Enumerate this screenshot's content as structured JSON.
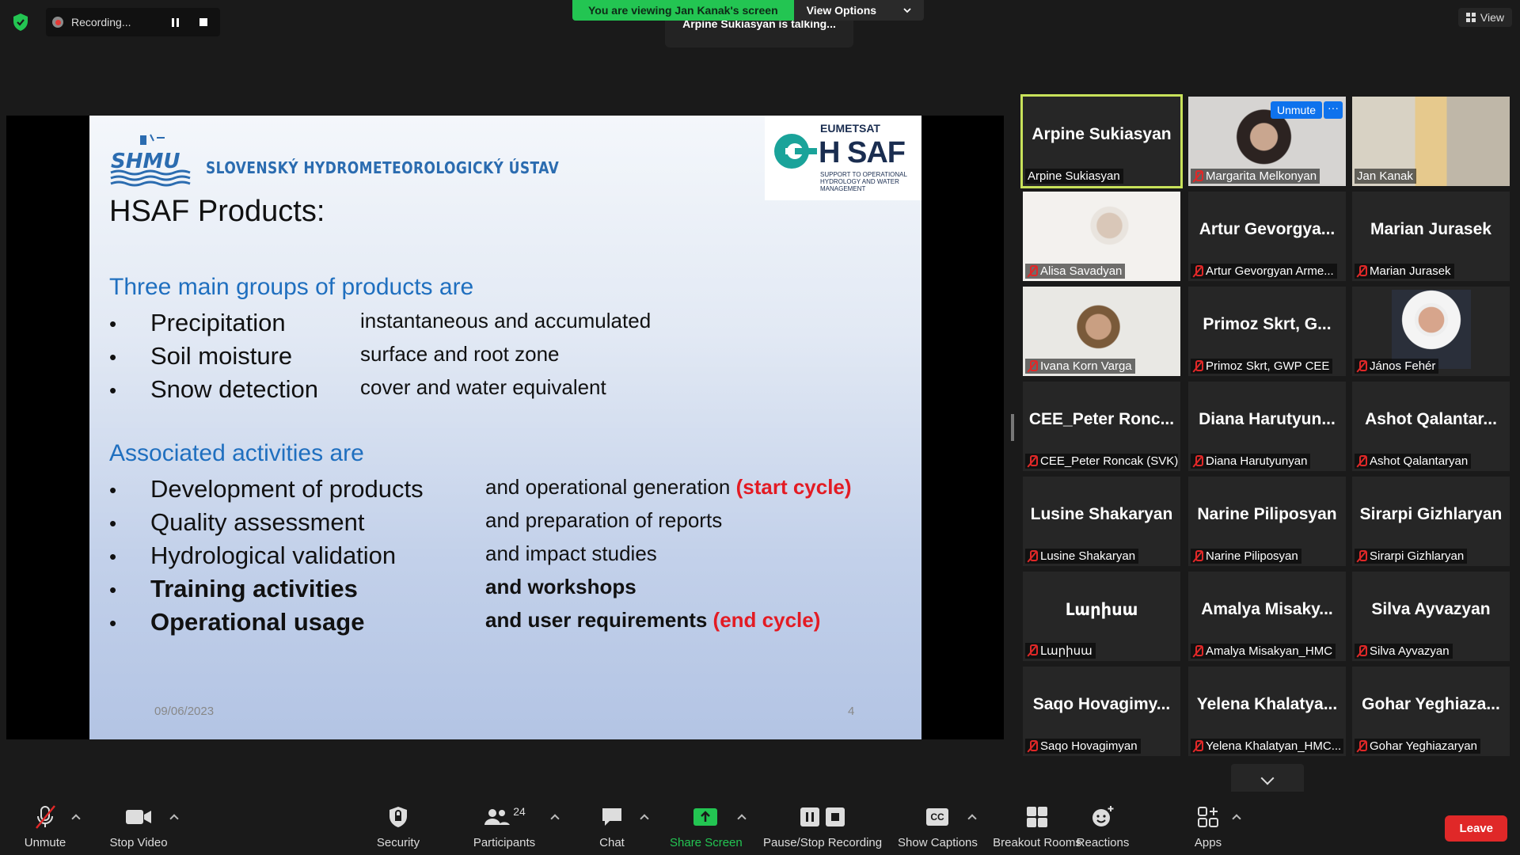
{
  "topbar": {
    "recording_label": "Recording...",
    "banner_text": "You are viewing Jan Kanak's screen",
    "view_options_label": "View Options",
    "talking_text": "Arpine Sukiasyan is talking...",
    "view_label": "View"
  },
  "slide": {
    "org_name": "SLOVENSKÝ HYDROMETEOROLOGICKÝ ÚSTAV",
    "shmu_logo_text": "SHMU",
    "eumetsat": "EUMETSAT",
    "hsaf_title": "H SAF",
    "hsaf_sub": "SUPPORT TO OPERATIONAL HYDROLOGY AND WATER MANAGEMENT",
    "title": "HSAF Products:",
    "section1": "Three main groups of products are",
    "products": [
      {
        "name": "Precipitation",
        "desc": "instantaneous and accumulated"
      },
      {
        "name": "Soil moisture",
        "desc": "surface and root zone"
      },
      {
        "name": "Snow detection",
        "desc": "cover and water equivalent"
      }
    ],
    "section2": "Associated activities are",
    "activities": [
      {
        "name": "Development of products",
        "desc": "and operational generation",
        "tag": "(start cycle)"
      },
      {
        "name": "Quality assessment",
        "desc": "and preparation of reports",
        "tag": ""
      },
      {
        "name": "Hydrological validation",
        "desc": "and impact studies",
        "tag": ""
      },
      {
        "name": "Training activities",
        "desc": "and workshops",
        "tag": ""
      },
      {
        "name": "Operational usage",
        "desc": "and user requirements",
        "tag": "(end cycle)"
      }
    ],
    "date": "09/06/2023",
    "page": "4"
  },
  "participants": [
    {
      "big": "Arpine Sukiasyan",
      "label": "Arpine Sukiasyan",
      "muted": false,
      "video": false,
      "active": true
    },
    {
      "big": "",
      "label": "Margarita Melkonyan",
      "muted": true,
      "video": true,
      "unmute_label": "Unmute",
      "more_label": "···"
    },
    {
      "big": "",
      "label": "Jan Kanak",
      "muted": false,
      "video": true
    },
    {
      "big": "",
      "label": "Alisa Savadyan",
      "muted": true,
      "video": true
    },
    {
      "big": "Artur Gevorgya...",
      "label": "Artur Gevorgyan Arme...",
      "muted": true,
      "video": false
    },
    {
      "big": "Marian Jurasek",
      "label": "Marian Jurasek",
      "muted": true,
      "video": false
    },
    {
      "big": "",
      "label": "Ivana Korn Varga",
      "muted": true,
      "video": true
    },
    {
      "big": "Primoz Skrt, G...",
      "label": "Primoz Skrt, GWP CEE",
      "muted": true,
      "video": false
    },
    {
      "big": "",
      "label": "János Fehér",
      "muted": true,
      "video": false,
      "photo": true
    },
    {
      "big": "CEE_Peter Ronc...",
      "label": "CEE_Peter Roncak (SVK)",
      "muted": true,
      "video": false
    },
    {
      "big": "Diana Harutyun...",
      "label": "Diana Harutyunyan",
      "muted": true,
      "video": false
    },
    {
      "big": "Ashot Qalantar...",
      "label": "Ashot Qalantaryan",
      "muted": true,
      "video": false
    },
    {
      "big": "Lusine Shakaryan",
      "label": "Lusine Shakaryan",
      "muted": true,
      "video": false
    },
    {
      "big": "Narine Piliposyan",
      "label": "Narine Piliposyan",
      "muted": true,
      "video": false
    },
    {
      "big": "Sirarpi Gizhlaryan",
      "label": "Sirarpi Gizhlaryan",
      "muted": true,
      "video": false
    },
    {
      "big": "Լարիսա",
      "label": "Լարիսա",
      "muted": true,
      "video": false
    },
    {
      "big": "Amalya Misaky...",
      "label": "Amalya Misakyan_HMC",
      "muted": true,
      "video": false
    },
    {
      "big": "Silva Ayvazyan",
      "label": "Silva Ayvazyan",
      "muted": true,
      "video": false
    },
    {
      "big": "Saqo Hovagimy...",
      "label": "Saqo Hovagimyan",
      "muted": true,
      "video": false
    },
    {
      "big": "Yelena Khalatya...",
      "label": "Yelena Khalatyan_HMC...",
      "muted": true,
      "video": false
    },
    {
      "big": "Gohar Yeghiaza...",
      "label": "Gohar Yeghiazaryan",
      "muted": true,
      "video": false
    }
  ],
  "toolbar": {
    "unmute": "Unmute",
    "stop_video": "Stop Video",
    "security": "Security",
    "participants": "Participants",
    "participants_count": "24",
    "chat": "Chat",
    "share_screen": "Share Screen",
    "pause_stop_recording": "Pause/Stop Recording",
    "show_captions": "Show Captions",
    "cc": "CC",
    "breakout_rooms": "Breakout Rooms",
    "reactions": "Reactions",
    "apps": "Apps",
    "leave": "Leave"
  },
  "colors": {
    "accent_green": "#23c552",
    "active_speaker": "#c8e25a",
    "leave_red": "#e02828",
    "slide_blue": "#1f6fbf",
    "slide_red": "#e31b23"
  }
}
